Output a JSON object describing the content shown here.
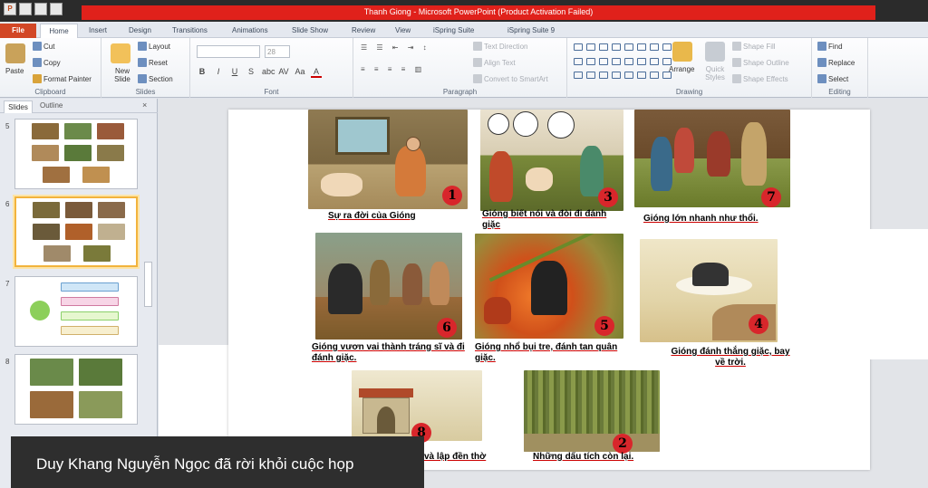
{
  "window": {
    "title": "Thanh Giong - Microsoft PowerPoint (Product Activation Failed)"
  },
  "qat": {
    "app_glyph": "P"
  },
  "tabs": [
    "File",
    "Home",
    "Insert",
    "Design",
    "Transitions",
    "Animations",
    "Slide Show",
    "Review",
    "View",
    "iSpring Suite",
    "iSpring Suite 9"
  ],
  "ribbon": {
    "clipboard": {
      "paste": "Paste",
      "cut": "Cut",
      "copy": "Copy",
      "format_painter": "Format Painter",
      "label": "Clipboard"
    },
    "slides": {
      "new_slide": "New Slide",
      "layout": "Layout",
      "reset": "Reset",
      "section": "Section",
      "label": "Slides"
    },
    "font": {
      "size": "28",
      "bold": "B",
      "italic": "I",
      "underline": "U",
      "strike": "S",
      "shadow": "abc",
      "spacing": "AV",
      "case": "Aa",
      "color": "A",
      "label": "Font"
    },
    "paragraph": {
      "text_direction": "Text Direction",
      "align_text": "Align Text",
      "smartart": "Convert to SmartArt",
      "label": "Paragraph"
    },
    "drawing": {
      "arrange": "Arrange",
      "quick_styles": "Quick Styles",
      "shape_fill": "Shape Fill",
      "shape_outline": "Shape Outline",
      "shape_effects": "Shape Effects",
      "label": "Drawing"
    },
    "editing": {
      "find": "Find",
      "replace": "Replace",
      "select": "Select",
      "label": "Editing"
    }
  },
  "pane": {
    "tab_slides": "Slides",
    "tab_outline": "Outline",
    "close": "×",
    "slide_numbers": [
      "5",
      "6",
      "7",
      "8"
    ]
  },
  "slide": {
    "panels": [
      {
        "number": "1",
        "caption": "Sự ra đời của Gióng"
      },
      {
        "number": "3",
        "caption": "Gióng biết nói và đòi đi đánh giặc"
      },
      {
        "number": "7",
        "caption": "Gióng lớn nhanh như thổi."
      },
      {
        "number": "6",
        "caption": "Gióng vươn vai thành tráng sĩ và đi đánh giặc."
      },
      {
        "number": "5",
        "caption": "Gióng nhổ bụi tre, đánh tan quân giặc."
      },
      {
        "number": "4",
        "caption": "Gióng đánh thắng giặc, bay về trời."
      },
      {
        "number": "8",
        "caption": "và lập đền thờ"
      },
      {
        "number": "2",
        "caption": "Những dấu tích còn lại."
      }
    ]
  },
  "notification": {
    "text": "Duy Khang Nguyễn Ngọc đã rời khỏi cuộc họp"
  },
  "colors": {
    "file_tab": "#d24726",
    "title_strip": "#e0211b",
    "badge": "#d8262b"
  }
}
